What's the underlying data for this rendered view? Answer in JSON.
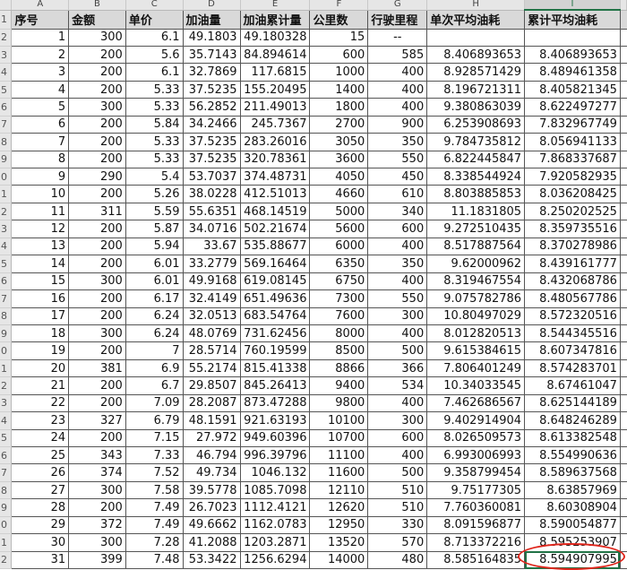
{
  "columns": [
    "A",
    "B",
    "C",
    "D",
    "E",
    "F",
    "G",
    "H",
    "I",
    ""
  ],
  "headers": [
    "序号",
    "金额",
    "单价",
    "加油量",
    "加油累计量",
    "公里数",
    "行驶里程",
    "单次平均油耗",
    "累计平均油耗",
    ""
  ],
  "selected_cell": "I32",
  "rows": [
    [
      "1",
      "300",
      "6.1",
      "49.1803",
      "49.180328",
      "15",
      "--",
      "",
      ""
    ],
    [
      "2",
      "200",
      "5.6",
      "35.7143",
      "84.894614",
      "600",
      "585",
      "8.406893653",
      "8.406893653"
    ],
    [
      "3",
      "200",
      "6.1",
      "32.7869",
      "117.6815",
      "1000",
      "400",
      "8.928571429",
      "8.489461358"
    ],
    [
      "4",
      "200",
      "5.33",
      "37.5235",
      "155.20495",
      "1400",
      "400",
      "8.196721311",
      "8.405821345"
    ],
    [
      "5",
      "300",
      "5.33",
      "56.2852",
      "211.49013",
      "1800",
      "400",
      "9.380863039",
      "8.622497277"
    ],
    [
      "6",
      "200",
      "5.84",
      "34.2466",
      "245.7367",
      "2700",
      "900",
      "6.253908693",
      "7.832967749"
    ],
    [
      "7",
      "200",
      "5.33",
      "37.5235",
      "283.26016",
      "3050",
      "350",
      "9.784735812",
      "8.056941133"
    ],
    [
      "8",
      "200",
      "5.33",
      "37.5235",
      "320.78361",
      "3600",
      "550",
      "6.822445847",
      "7.868337687"
    ],
    [
      "9",
      "290",
      "5.4",
      "53.7037",
      "374.48731",
      "4050",
      "450",
      "8.338544924",
      "7.920582935"
    ],
    [
      "10",
      "200",
      "5.26",
      "38.0228",
      "412.51013",
      "4660",
      "610",
      "8.803885853",
      "8.036208425"
    ],
    [
      "11",
      "311",
      "5.59",
      "55.6351",
      "468.14519",
      "5000",
      "340",
      "11.1831805",
      "8.250202525"
    ],
    [
      "12",
      "200",
      "5.87",
      "34.0716",
      "502.21674",
      "5600",
      "600",
      "9.272510435",
      "8.359735516"
    ],
    [
      "13",
      "200",
      "5.94",
      "33.67",
      "535.88677",
      "6000",
      "400",
      "8.517887564",
      "8.370278986"
    ],
    [
      "14",
      "200",
      "6.01",
      "33.2779",
      "569.16464",
      "6350",
      "350",
      "9.62000962",
      "8.439161777"
    ],
    [
      "15",
      "300",
      "6.01",
      "49.9168",
      "619.08145",
      "6750",
      "400",
      "8.319467554",
      "8.432068786"
    ],
    [
      "16",
      "200",
      "6.17",
      "32.4149",
      "651.49636",
      "7300",
      "550",
      "9.075782786",
      "8.480567786"
    ],
    [
      "17",
      "200",
      "6.24",
      "32.0513",
      "683.54764",
      "7600",
      "300",
      "10.80497029",
      "8.572320516"
    ],
    [
      "18",
      "300",
      "6.24",
      "48.0769",
      "731.62456",
      "8000",
      "400",
      "8.012820513",
      "8.544345516"
    ],
    [
      "19",
      "200",
      "7",
      "28.5714",
      "760.19599",
      "8500",
      "500",
      "9.615384615",
      "8.607347816"
    ],
    [
      "20",
      "381",
      "6.9",
      "55.2174",
      "815.41338",
      "8866",
      "366",
      "7.806401249",
      "8.574283701"
    ],
    [
      "21",
      "200",
      "6.7",
      "29.8507",
      "845.26413",
      "9400",
      "534",
      "10.34033545",
      "8.67461047"
    ],
    [
      "22",
      "200",
      "7.09",
      "28.2087",
      "873.47288",
      "9800",
      "400",
      "7.462686567",
      "8.625144189"
    ],
    [
      "23",
      "327",
      "6.79",
      "48.1591",
      "921.63193",
      "10100",
      "300",
      "9.402914904",
      "8.648246289"
    ],
    [
      "24",
      "200",
      "7.15",
      "27.972",
      "949.60396",
      "10700",
      "600",
      "8.026509573",
      "8.613382548"
    ],
    [
      "25",
      "343",
      "7.33",
      "46.794",
      "996.39796",
      "11100",
      "400",
      "6.993006993",
      "8.554990636"
    ],
    [
      "26",
      "374",
      "7.52",
      "49.734",
      "1046.132",
      "11600",
      "500",
      "9.358799454",
      "8.589637568"
    ],
    [
      "27",
      "300",
      "7.58",
      "39.5778",
      "1085.7098",
      "12110",
      "510",
      "9.75177305",
      "8.63857969"
    ],
    [
      "28",
      "200",
      "7.49",
      "26.7023",
      "1112.4121",
      "12620",
      "510",
      "7.760360081",
      "8.60308904"
    ],
    [
      "29",
      "372",
      "7.49",
      "49.6662",
      "1162.0783",
      "12950",
      "330",
      "8.091596877",
      "8.590054877"
    ],
    [
      "30",
      "300",
      "7.28",
      "41.2088",
      "1203.2871",
      "13520",
      "570",
      "8.713372216",
      "8.595253907"
    ],
    [
      "31",
      "399",
      "7.48",
      "53.3422",
      "1256.6294",
      "14000",
      "480",
      "8.585164835",
      "8.594907995"
    ]
  ]
}
